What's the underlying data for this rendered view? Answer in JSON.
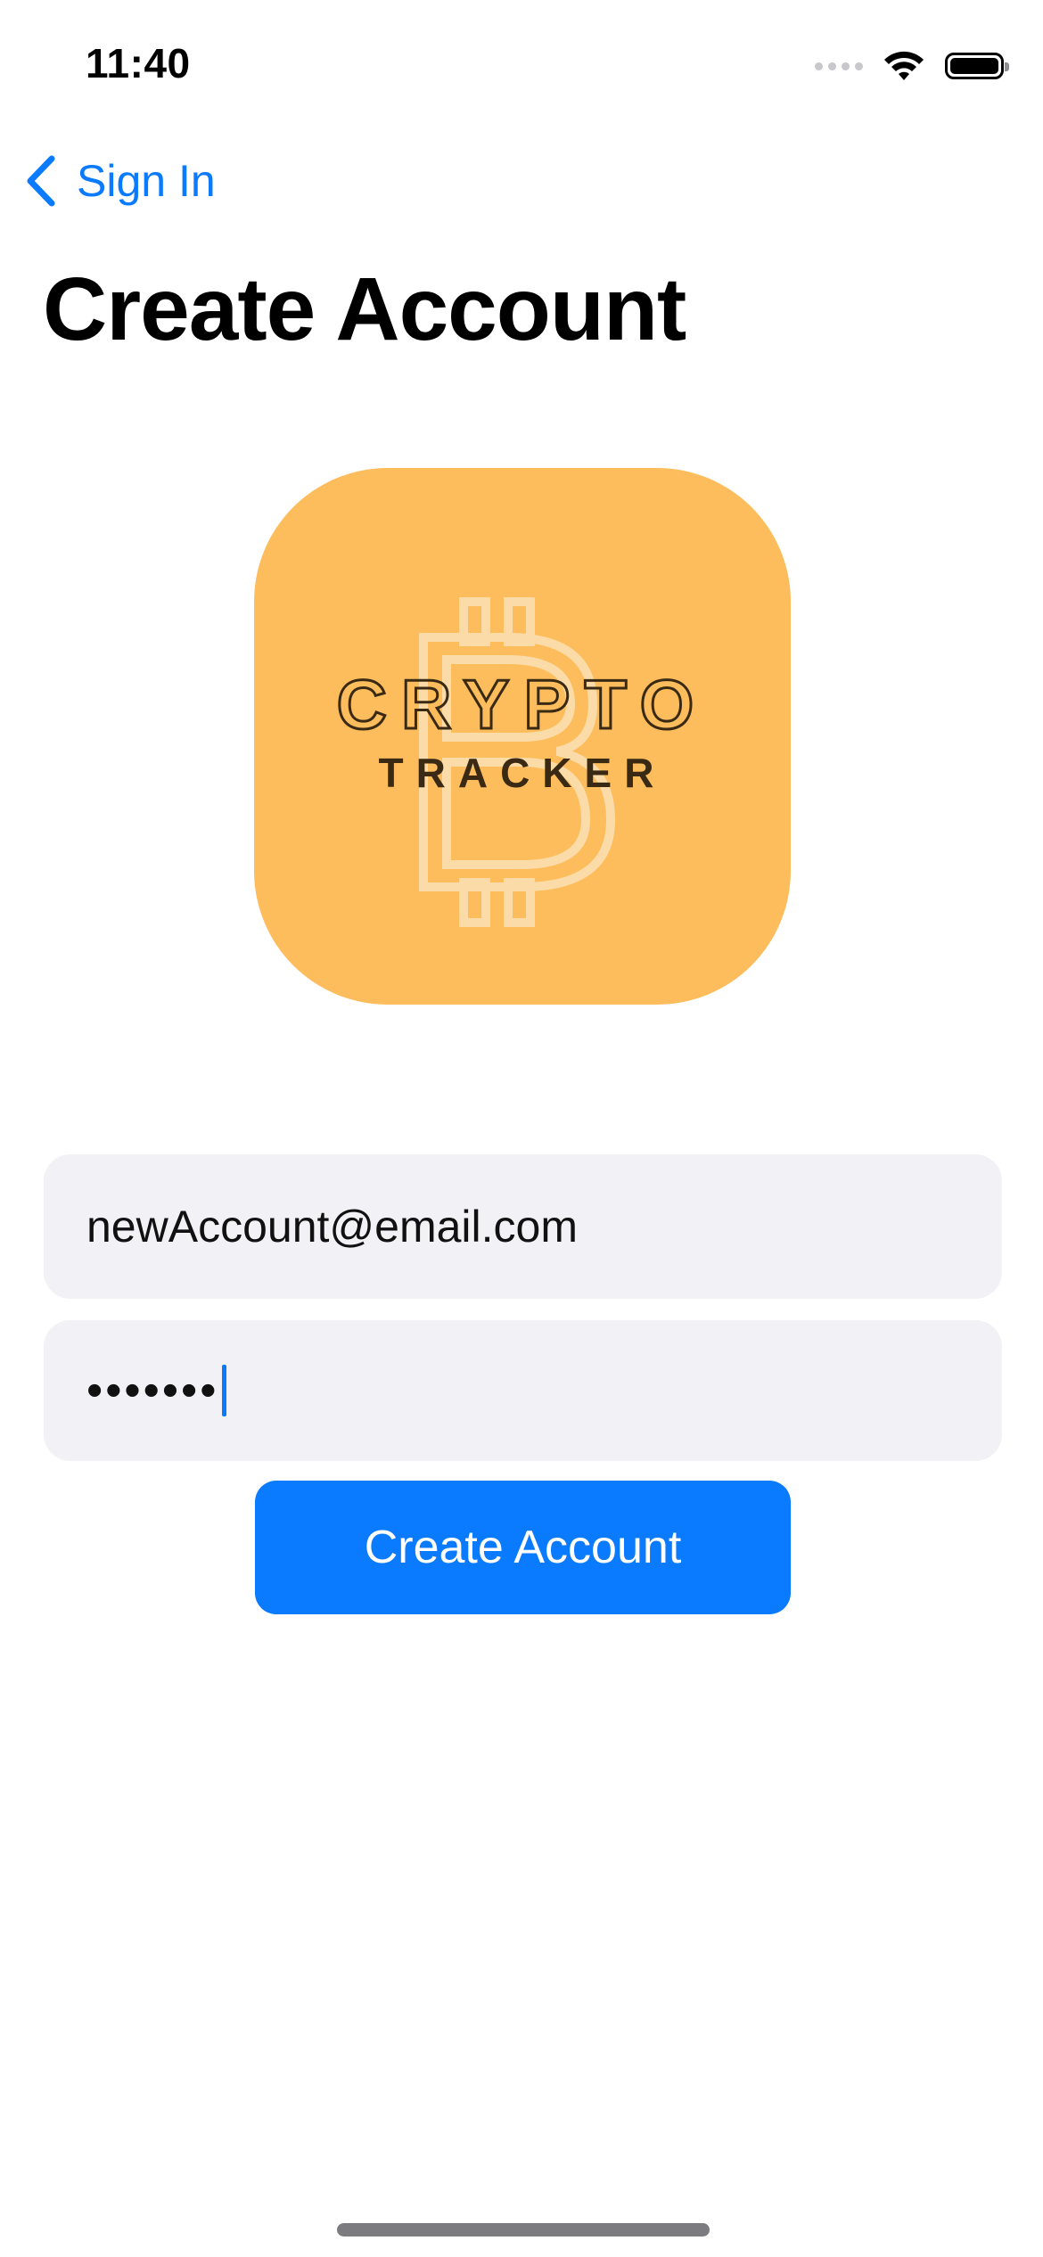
{
  "status_bar": {
    "time": "11:40",
    "icons": [
      "cellular-icon",
      "wifi-icon",
      "battery-icon"
    ]
  },
  "nav": {
    "back_label": "Sign In",
    "back_icon": "chevron-left-icon"
  },
  "page": {
    "title": "Create Account"
  },
  "logo": {
    "line1": "CRYPTO",
    "line2": "TRACKER",
    "icon": "bitcoin-icon",
    "background_color": "#fdbd5c"
  },
  "form": {
    "email_value": "newAccount@email.com",
    "password_masked": "•••••••"
  },
  "button": {
    "label": "Create Account",
    "color": "#0a7aff"
  },
  "colors": {
    "accent": "#0a7aff",
    "field_bg": "#f1f1f6"
  }
}
